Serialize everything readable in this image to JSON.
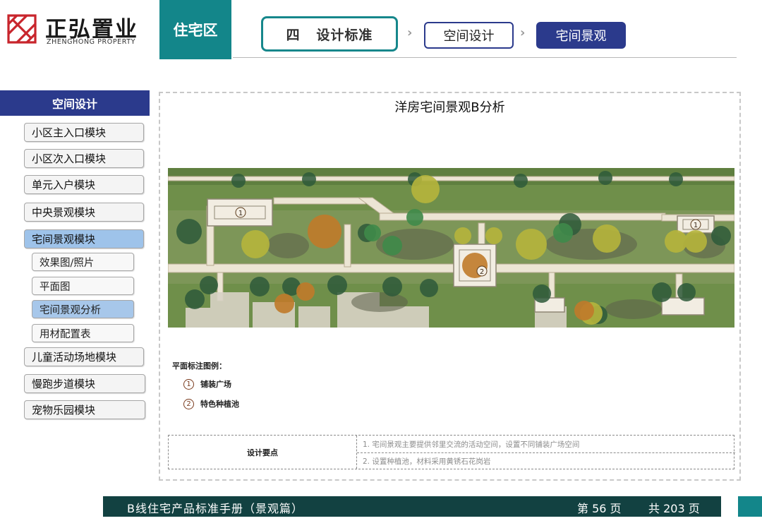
{
  "brand": {
    "name_cn": "正弘置业",
    "name_en": "ZHENGHONG PROPERTY",
    "color": "#c8252c"
  },
  "header": {
    "zone_tab": "住宅区",
    "breadcrumb": [
      {
        "label": "四   设计标准"
      },
      {
        "label": "空间设计"
      },
      {
        "label": "宅间景观"
      }
    ],
    "chevron": "›",
    "accent_teal": "#13868a",
    "accent_navy": "#2b3a8c"
  },
  "sidebar": {
    "heading": "空间设计",
    "items": [
      {
        "label": "小区主入口模块"
      },
      {
        "label": "小区次入口模块"
      },
      {
        "label": "单元入户模块"
      },
      {
        "label": "中央景观模块"
      },
      {
        "label": "宅间景观模块"
      },
      {
        "label": "效果图/照片"
      },
      {
        "label": "平面图"
      },
      {
        "label": "宅间景观分析"
      },
      {
        "label": "用材配置表"
      },
      {
        "label": "儿童活动场地模块"
      },
      {
        "label": "慢跑步道模块"
      },
      {
        "label": "宠物乐园模块"
      }
    ],
    "active_item": "宅间景观模块",
    "active_sub_item": "宅间景观分析"
  },
  "content": {
    "title": "洋房宅间景观B分析",
    "plan_markers": [
      "1",
      "2",
      "1"
    ],
    "legend": {
      "title": "平面标注图例：",
      "entries": [
        {
          "num": "1",
          "label": "铺装广场"
        },
        {
          "num": "2",
          "label": "特色种植池"
        }
      ]
    },
    "design_points": {
      "label": "设计要点",
      "lines": [
        "1. 宅间景观主要提供邻里交流的活动空间，设置不同铺装广场空间",
        "2. 设置种植池，材料采用黄锈石花岗岩"
      ]
    }
  },
  "footer": {
    "title": "B线住宅产品标准手册（景观篇）",
    "page": "第 56 页",
    "total": "共 203 页"
  }
}
